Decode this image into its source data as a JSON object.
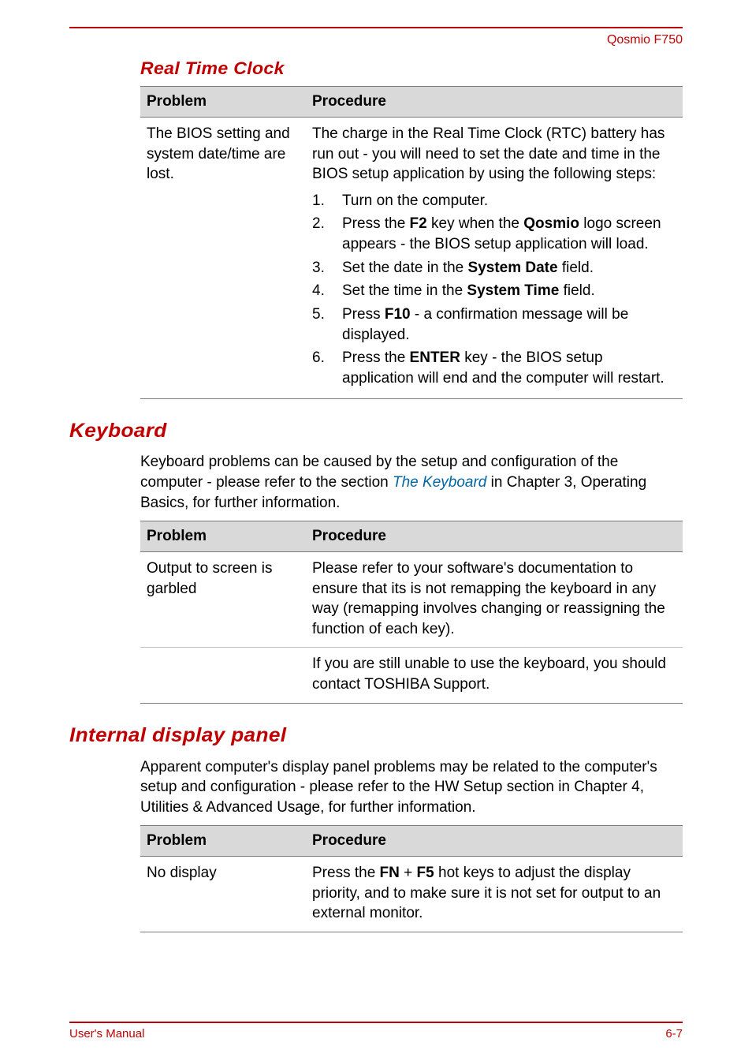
{
  "header": {
    "product": "Qosmio F750"
  },
  "rtc": {
    "title": "Real Time Clock",
    "colProblem": "Problem",
    "colProcedure": "Procedure",
    "problem": "The BIOS setting and system date/time are lost.",
    "intro_a": "The charge in the Real Time Clock (RTC) battery has run out - you will need to set the date and time in the BIOS setup application by using the following steps:",
    "step1": "Turn on the computer.",
    "step2_a": "Press the ",
    "step2_b": "F2",
    "step2_c": " key when the ",
    "step2_d": "Qosmio",
    "step2_e": " logo screen appears - the BIOS setup application will load.",
    "step3_a": "Set the date in the ",
    "step3_b": "System Date",
    "step3_c": " field.",
    "step4_a": "Set the time in the ",
    "step4_b": "System Time",
    "step4_c": " field.",
    "step5_a": "Press ",
    "step5_b": "F10",
    "step5_c": " - a confirmation message will be displayed.",
    "step6_a": "Press the ",
    "step6_b": "ENTER",
    "step6_c": " key - the BIOS setup application will end and the computer will restart."
  },
  "keyboard": {
    "title": "Keyboard",
    "intro_a": "Keyboard problems can be caused by the setup and configuration of the computer - please refer to the section ",
    "intro_link": "The Keyboard",
    "intro_b": " in Chapter 3, Operating Basics, for further information.",
    "colProblem": "Problem",
    "colProcedure": "Procedure",
    "row1_problem": "Output to screen is garbled",
    "row1_proc": "Please refer to your software's documentation to ensure that its is not remapping the keyboard in any way (remapping involves changing or reassigning the function of each key).",
    "row2_proc": "If you are still unable to use the keyboard, you should contact TOSHIBA Support."
  },
  "panel": {
    "title": "Internal display panel",
    "intro": "Apparent computer's display panel problems may be related to the computer's setup and configuration - please refer to the HW Setup section in Chapter 4, Utilities & Advanced Usage, for further information.",
    "colProblem": "Problem",
    "colProcedure": "Procedure",
    "row1_problem": "No display",
    "row1_a": "Press the ",
    "row1_b": "FN",
    "row1_c": " + ",
    "row1_d": "F5",
    "row1_e": " hot keys to adjust the display priority, and to make sure it is not set for output to an external monitor."
  },
  "footer": {
    "left": "User's Manual",
    "right": "6-7"
  }
}
